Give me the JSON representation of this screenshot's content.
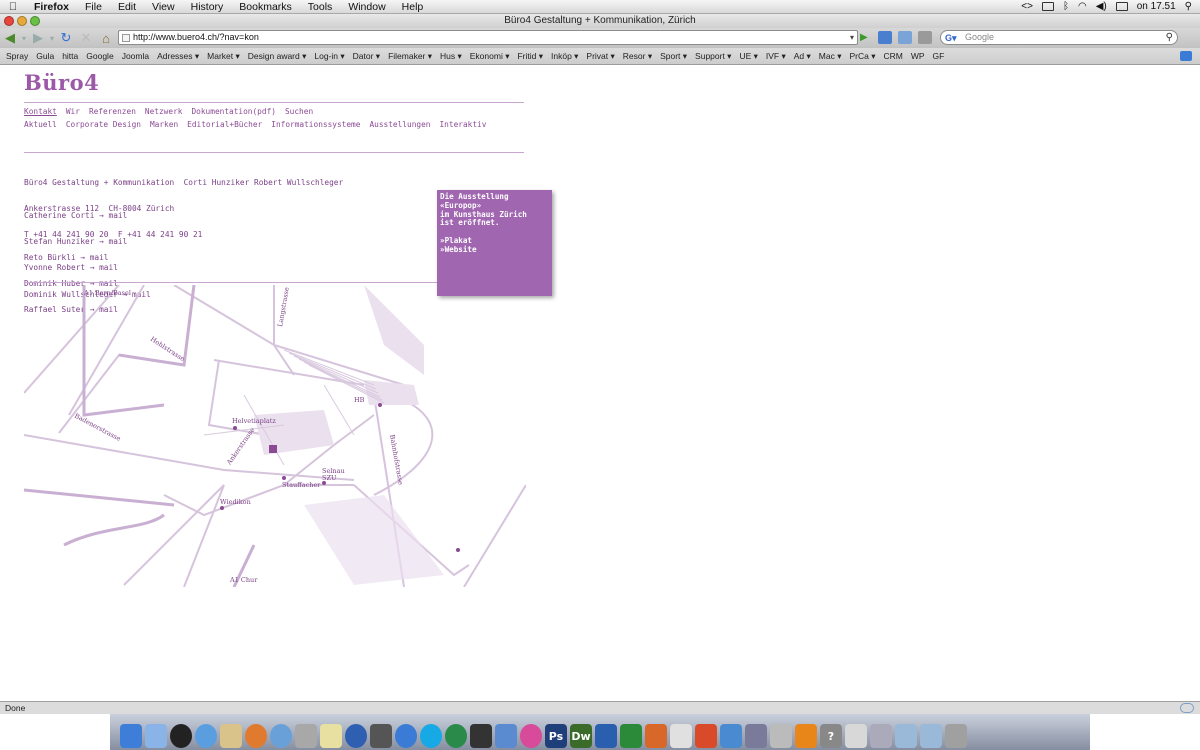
{
  "menubar": {
    "app_name": "Firefox",
    "items": [
      "File",
      "Edit",
      "View",
      "History",
      "Bookmarks",
      "Tools",
      "Window",
      "Help"
    ],
    "clock": "on 17.51"
  },
  "window": {
    "title": "Büro4 Gestaltung + Kommunikation, Zürich"
  },
  "toolbar": {
    "url": "http://www.buero4.ch/?nav=kon",
    "search_placeholder": "Google"
  },
  "bookmarks": [
    "Spray",
    "Gula",
    "hitta",
    "Google",
    "Joomla",
    "Adresses ▾",
    "Market ▾",
    "Design award ▾",
    "Log-in ▾",
    "Dator ▾",
    "Filemaker ▾",
    "Hus ▾",
    "Ekonomi ▾",
    "Fritid ▾",
    "Inköp ▾",
    "Privat ▾",
    "Resor ▾",
    "Sport ▾",
    "Support ▾",
    "UE ▾",
    "IVF ▾",
    "Ad ▾",
    "Mac ▾",
    "PrCa ▾",
    "CRM",
    "WP",
    "GF"
  ],
  "page": {
    "logo": "Büro4",
    "nav_primary": [
      "Kontakt",
      "Wir",
      "Referenzen",
      "Netzwerk",
      "Dokumentation(pdf)",
      "Suchen"
    ],
    "nav_secondary": [
      "Aktuell",
      "Corporate Design",
      "Marken",
      "Editorial+Bücher",
      "Informationssysteme",
      "Ausstellungen",
      "Interaktiv"
    ],
    "contact": {
      "line1": "Büro4 Gestaltung + Kommunikation  Corti Hunziker Robert Wullschleger",
      "line2": "Ankerstrasse 112  CH-8004 Zürich",
      "line3": "T +41 44 241 90 20  F +41 44 241 90 21"
    },
    "people_group1": [
      "Catherine Corti → mail",
      "Stefan Hunziker → mail",
      "Yvonne Robert → mail",
      "Dominik Wullschleger → mail"
    ],
    "people_group2": [
      "Reto Bürkli → mail",
      "Dominik Huber → mail",
      "Raffael Suter → mail"
    ],
    "popup": {
      "line1": "Die Ausstellung",
      "line2": "«Europop»",
      "line3": "im Kunsthaus Zürich",
      "line4": "ist eröffnet.",
      "link1": "»Plakat",
      "link2": "»Website"
    },
    "map_labels": {
      "bern": "A1 Bern/Basel",
      "hohl": "Hohlstrasse",
      "lang": "Langstrasse",
      "baden": "Badenerstrasse",
      "helvetia": "Helvetiaplatz",
      "anker": "Ankerstrasse",
      "hb": "HB",
      "bahnhof": "Bahnhofstrasse",
      "stauffacher": "Stauffacher",
      "selnau": "Selnau",
      "szu": "SZU",
      "wiedikon": "Wiedikon",
      "chur": "A1 Chur",
      "tram_hb": "3\n14",
      "tram_helv": "8\n12",
      "tram_stauf": "3 2\n14 9"
    }
  },
  "status": {
    "text": "Done"
  },
  "dock_apps": [
    "finder",
    "mail",
    "clock",
    "safari",
    "preview",
    "firefox",
    "itunes",
    "iphoto",
    "games",
    "dvd",
    "skype",
    "ichat",
    "tool",
    "time",
    "photoshop-cs",
    "pinwheel",
    "Ps",
    "Dw",
    "word",
    "excel",
    "powerpoint",
    "calendar",
    "entourage",
    "notes",
    "terminal",
    "folder",
    "cone",
    "help",
    "preview2",
    "disk",
    "downloads",
    "folder2",
    "trash"
  ]
}
